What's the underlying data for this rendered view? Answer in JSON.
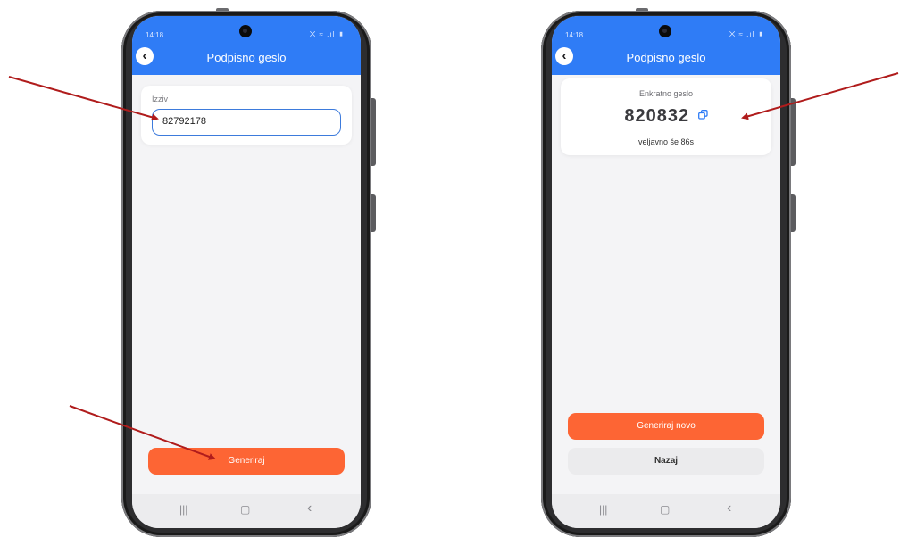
{
  "status_bar": {
    "time": "14:18",
    "icons": "⨉ ≈ .ıl ▮"
  },
  "left_screen": {
    "title": "Podpisno geslo",
    "challenge": {
      "label": "Izziv",
      "value": "82792178"
    },
    "generate_label": "Generiraj",
    "nav": {
      "recent": "|||",
      "home": "▢",
      "back": "‹"
    }
  },
  "right_screen": {
    "title": "Podpisno geslo",
    "otp": {
      "label": "Enkratno geslo",
      "value": "820832",
      "validity": "veljavno še 86s"
    },
    "generate_new_label": "Generiraj novo",
    "back_label": "Nazaj",
    "nav": {
      "recent": "|||",
      "home": "▢",
      "back": "‹"
    }
  },
  "colors": {
    "header": "#2f7cf6",
    "primary_button": "#fd6534",
    "annotation_arrow": "#b01c1c"
  },
  "icons": {
    "back": "chevron-left-icon",
    "copy": "copy-icon"
  }
}
